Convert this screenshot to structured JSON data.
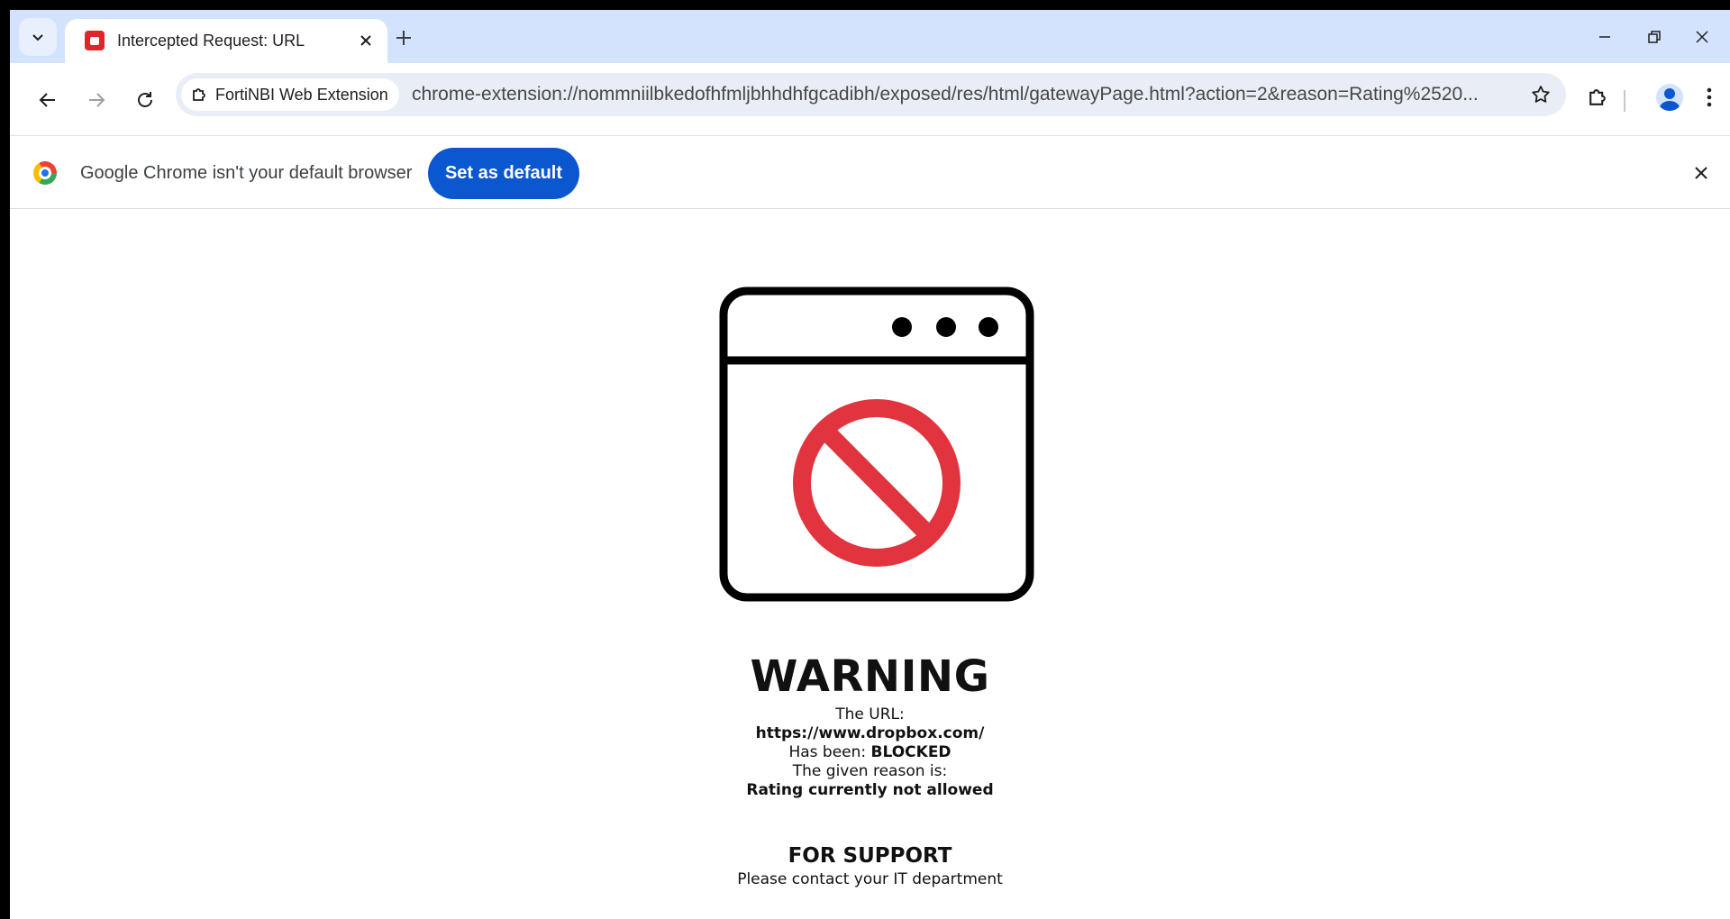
{
  "browser": {
    "tab": {
      "title": "Intercepted Request: URL"
    },
    "omnibox": {
      "extension_chip": "FortiNBI Web Extension",
      "url": "chrome-extension://nommniilbkedofhfmljbhhdhfgcadibh/exposed/res/html/gatewayPage.html?action=2&reason=Rating%2520..."
    },
    "infobar": {
      "message": "Google Chrome isn't your default browser",
      "button": "Set as default"
    }
  },
  "page": {
    "title": "WARNING",
    "url_label": "The URL:",
    "url": "https://www.dropbox.com/",
    "status_label": "Has been: ",
    "status": "BLOCKED",
    "reason_label": "The given reason is:",
    "reason": "Rating currently not allowed",
    "support_title": "FOR SUPPORT",
    "support_text": "Please contact your IT department"
  },
  "colors": {
    "tabstrip": "#d3e3fd",
    "accent_button": "#0b57d0",
    "block_icon": "#e2343f"
  }
}
